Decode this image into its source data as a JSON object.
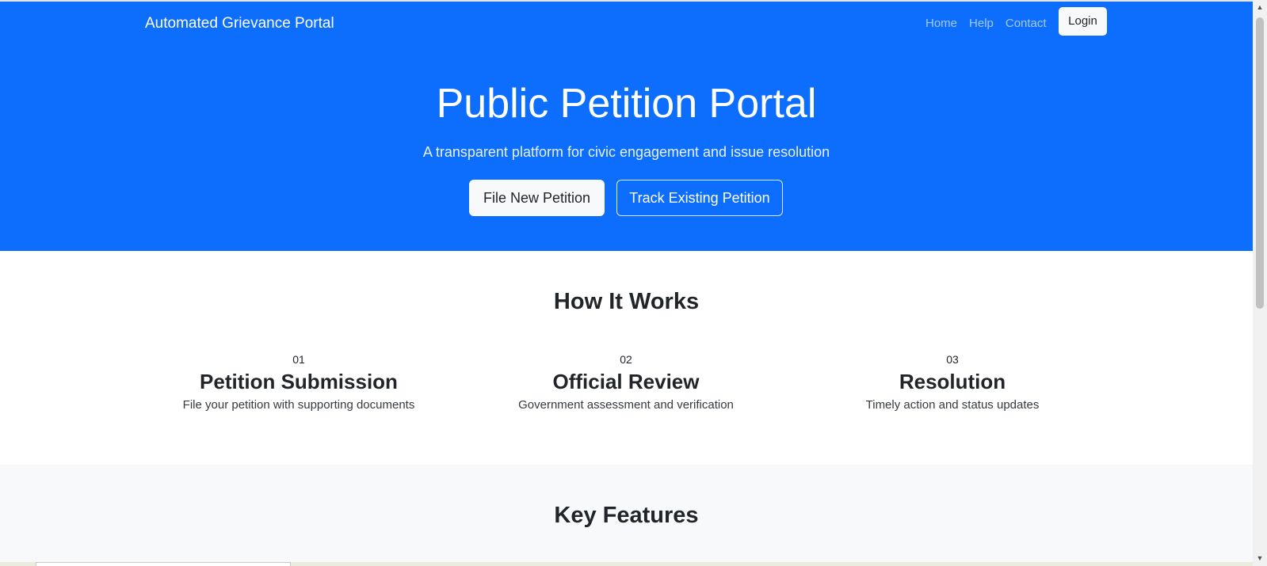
{
  "navbar": {
    "brand": "Automated Grievance Portal",
    "links": [
      {
        "label": "Home"
      },
      {
        "label": "Help"
      },
      {
        "label": "Contact"
      }
    ],
    "login_label": "Login"
  },
  "hero": {
    "title": "Public Petition Portal",
    "subtitle": "A transparent platform for civic engagement and issue resolution",
    "primary_button": "File New Petition",
    "secondary_button": "Track Existing Petition"
  },
  "how_it_works": {
    "title": "How It Works",
    "steps": [
      {
        "number": "01",
        "title": "Petition Submission",
        "description": "File your petition with supporting documents"
      },
      {
        "number": "02",
        "title": "Official Review",
        "description": "Government assessment and verification"
      },
      {
        "number": "03",
        "title": "Resolution",
        "description": "Timely action and status updates"
      }
    ]
  },
  "key_features": {
    "title": "Key Features"
  },
  "scrollbar": {
    "up_icon": "chevron-up-icon",
    "down_icon": "chevron-down-icon"
  },
  "colors": {
    "primary": "#0d6efd",
    "light": "#f8f9fa",
    "dark_text": "#212529"
  }
}
